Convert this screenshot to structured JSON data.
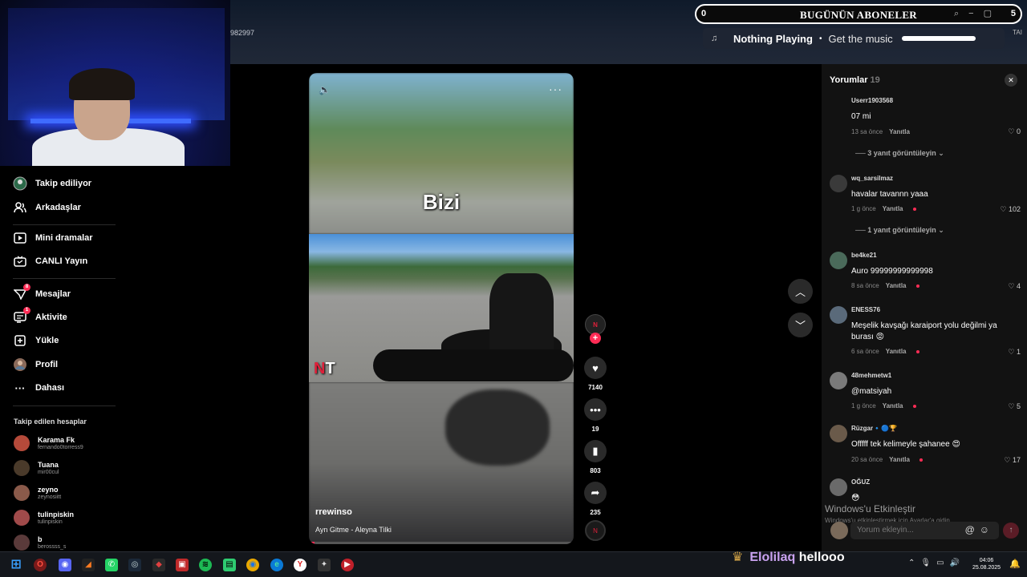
{
  "header": {
    "id_text": "982997",
    "lang_text": "TAI"
  },
  "sub_widget": {
    "count_left": "0",
    "title": "BUGÜNÜN ABONELER",
    "count_right": "5"
  },
  "music": {
    "now_playing": "Nothing Playing",
    "cta": "Get the music"
  },
  "sidebar": {
    "nav": [
      {
        "label": "Takip ediliyor",
        "icon": "following-icon"
      },
      {
        "label": "Arkadaşlar",
        "icon": "friends-icon"
      },
      {
        "label": "Mini dramalar",
        "icon": "mini-drama-icon"
      },
      {
        "label": "CANLI Yayın",
        "icon": "live-icon"
      },
      {
        "label": "Mesajlar",
        "icon": "messages-icon",
        "badge": "8"
      },
      {
        "label": "Aktivite",
        "icon": "activity-icon",
        "badge": "1"
      },
      {
        "label": "Yükle",
        "icon": "upload-icon"
      },
      {
        "label": "Profil",
        "icon": "profile-icon"
      },
      {
        "label": "Dahası",
        "icon": "more-icon"
      }
    ],
    "followed_title": "Takip edilen hesaplar",
    "followed": [
      {
        "name": "Karama Fk",
        "user": "fernando0torress9",
        "color": "#b54a3a"
      },
      {
        "name": "Tuana",
        "user": "mir00cul",
        "color": "#4a3a2a"
      },
      {
        "name": "zeyno",
        "user": "zeynosiitt",
        "color": "#8a5a4a"
      },
      {
        "name": "tulinpiskin",
        "user": "tulinpiskin",
        "color": "#a04a4a"
      },
      {
        "name": "b",
        "user": "berossss_s",
        "color": "#5a3a3a"
      }
    ]
  },
  "video": {
    "caption_overlay": "Bizi",
    "watermark_a": "N",
    "watermark_b": "T",
    "creator": "rrewinso",
    "music_line": "Ayn Gitme - Aleyna Tilki",
    "progress": 0.02
  },
  "actions": {
    "creator_badge": "N",
    "likes": "7140",
    "comments": "19",
    "saves": "803",
    "shares": "235"
  },
  "comments": {
    "title": "Yorumlar",
    "count": "19",
    "reply_label": "Yanıtla",
    "items": [
      {
        "user": "Userr1903568",
        "text": "07 mi",
        "time": "13 sa önce",
        "likes": "0",
        "liked": false,
        "avatar": ""
      },
      {
        "user": "wq_sarsilmaz",
        "text": "havalar tavannn yaaa",
        "time": "1 g önce",
        "likes": "102",
        "liked": true,
        "avatar": "#3a3a3a"
      },
      {
        "user": "be4ke21",
        "text": "Auro 99999999999998",
        "time": "8 sa önce",
        "likes": "4",
        "liked": true,
        "avatar": "#4a6a5a"
      },
      {
        "user": "ENESS76",
        "text": "Meşelik kavşağı karaiport yolu değilmi ya burası 😡",
        "time": "6 sa önce",
        "likes": "1",
        "liked": true,
        "avatar": "#5a6a7a"
      },
      {
        "user": "48mehmetw1",
        "text": "@matsiyah",
        "time": "1 g önce",
        "likes": "5",
        "liked": true,
        "avatar": "#7a7a7a"
      },
      {
        "user": "Rüzgar🔹🔵🏆",
        "text": "Offfff tek kelimeyle şahanee 😍",
        "time": "20 sa önce",
        "likes": "17",
        "liked": true,
        "avatar": "#6a5a4a"
      },
      {
        "user": "OĞUZ",
        "text": "😳",
        "time": "",
        "likes": "",
        "liked": false,
        "avatar": "#6a6a6a"
      }
    ],
    "reply_toggles": [
      "3 yanıt görüntüleyin",
      "1 yanıt görüntüleyin"
    ],
    "input_placeholder": "Yorum ekleyin...",
    "input_icons": "@☺"
  },
  "windows": {
    "activate_title": "Windows'u Etkinleştir",
    "activate_sub": "Windows'u etkinleştirmek için Ayarlar'a gidin."
  },
  "chat": {
    "user": "Elolilaq",
    "message": "hellooo"
  },
  "taskbar": {
    "time": "04:06",
    "date": "25.08.2025"
  }
}
